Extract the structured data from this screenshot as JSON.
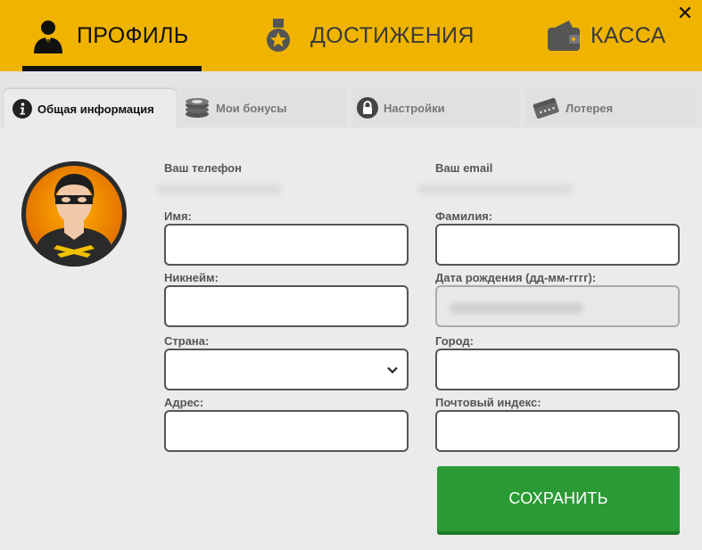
{
  "header": {
    "tabs": [
      {
        "label": "ПРОФИЛЬ",
        "icon": "user-tie-icon",
        "active": true
      },
      {
        "label": "ДОСТИЖЕНИЯ",
        "icon": "medal-icon",
        "active": false
      },
      {
        "label": "КАССА",
        "icon": "wallet-icon",
        "active": false
      }
    ],
    "close_label": "✕"
  },
  "subtabs": [
    {
      "label": "Общая информация",
      "icon": "info-icon",
      "active": true
    },
    {
      "label": "Мои бонусы",
      "icon": "chips-icon",
      "active": false
    },
    {
      "label": "Настройки",
      "icon": "lock-icon",
      "active": false
    },
    {
      "label": "Лотерея",
      "icon": "tickets-icon",
      "active": false
    }
  ],
  "form": {
    "phone_label": "Ваш телефон",
    "email_label": "Ваш email",
    "first_name_label": "Имя:",
    "last_name_label": "Фамилия:",
    "nickname_label": "Никнейм:",
    "birthdate_label": "Дата рождения (дд-мм-гггг):",
    "country_label": "Страна:",
    "city_label": "Город:",
    "address_label": "Адрес:",
    "zip_label": "Почтовый индекс:"
  },
  "save_label": "СОХРАНИТЬ",
  "colors": {
    "accent": "#f0b400",
    "save": "#2a9a34",
    "background": "#ebebeb"
  }
}
